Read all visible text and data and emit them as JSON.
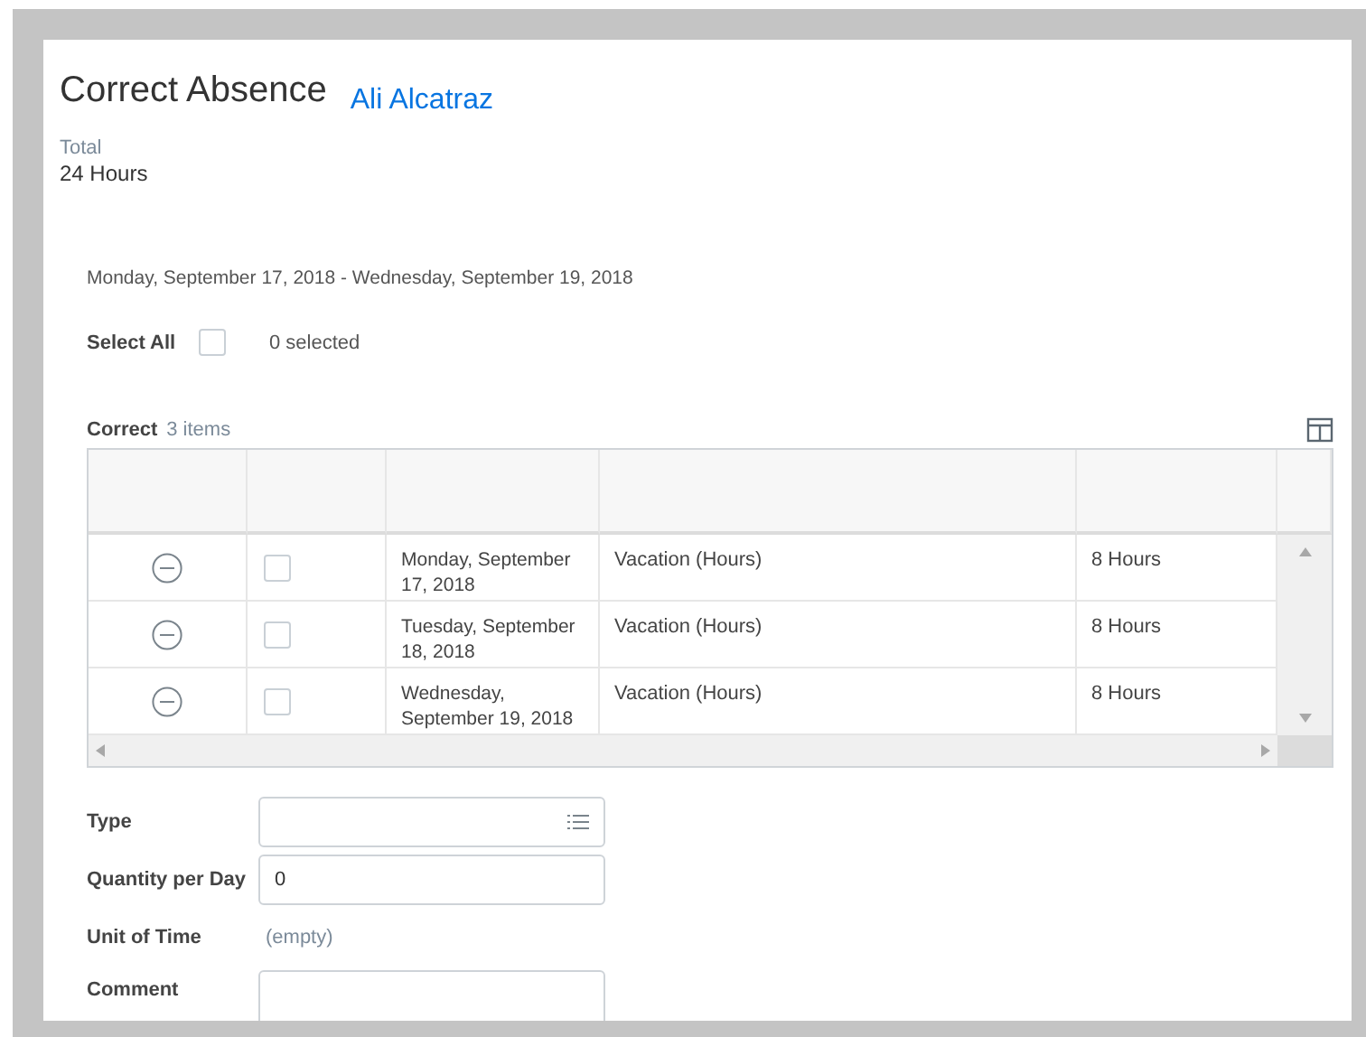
{
  "header": {
    "title": "Correct Absence",
    "worker": "Ali Alcatraz",
    "total_label": "Total",
    "total_value": "24 Hours"
  },
  "date_range": "Monday, September 17, 2018 - Wednesday, September 19, 2018",
  "select_all": {
    "label": "Select All",
    "checked": false,
    "count": "0 selected"
  },
  "grid": {
    "title": "Correct",
    "count": "3 items",
    "rows": [
      {
        "date": "Monday, September 17, 2018",
        "type": "Vacation (Hours)",
        "quantity": "8 Hours",
        "checked": false
      },
      {
        "date": "Tuesday, September 18, 2018",
        "type": "Vacation (Hours)",
        "quantity": "8 Hours",
        "checked": false
      },
      {
        "date": "Wednesday, September 19, 2018",
        "type": "Vacation (Hours)",
        "quantity": "8 Hours",
        "checked": false
      }
    ]
  },
  "form": [
    {
      "kind": "select",
      "label": "Type"
    },
    {
      "kind": "input",
      "label": "Quantity per Day",
      "value": "0"
    },
    {
      "kind": "readonly",
      "label": "Unit of Time",
      "value": "(empty)"
    },
    {
      "kind": "textarea",
      "label": "Comment"
    }
  ]
}
